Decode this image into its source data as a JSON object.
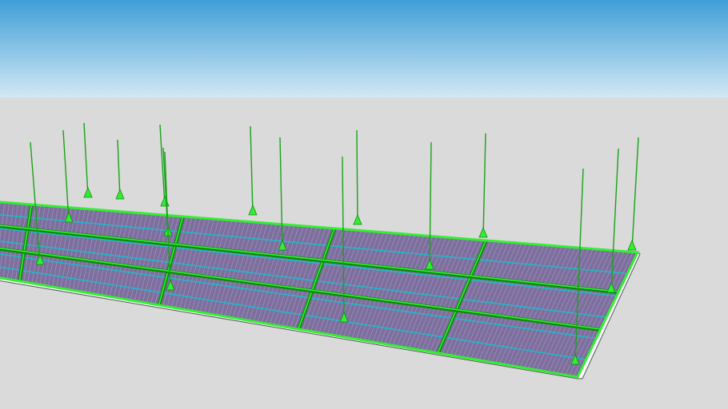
{
  "scene": {
    "view": "3d-perspective-model",
    "model": "suspended-ceiling-grid",
    "sky_top_color": "#3f9fd8",
    "sky_bottom_color": "#d2e8f4",
    "ground_color": "#dadada",
    "panel_color": "#7d6e9e",
    "panel_line_color": "#c9c3dc",
    "grid_color": "#0a8a0a",
    "grid_highlight_color": "#33ee33",
    "cross_tee_color": "#22b8c8",
    "hanger_wire_color": "#17a317",
    "slab_edge_color": "#ffffff",
    "hanger_wire_count": 16
  }
}
